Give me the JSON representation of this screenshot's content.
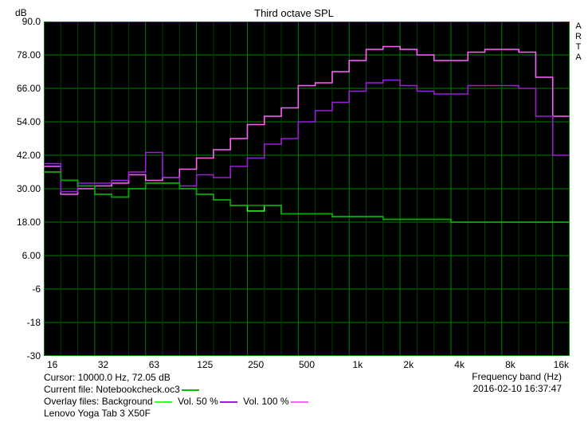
{
  "title": "Third octave SPL",
  "ylabel": "dB",
  "xlabel": "Frequency band (Hz)",
  "arta_label": "ARTA",
  "timestamp": "2016-02-10  16:37:47",
  "cursor_label": "Cursor: 10000.0 Hz, 72.05 dB",
  "file_label_prefix": "Current file: ",
  "file_name": "Notebookcheck.oc3",
  "overlay_label_prefix": "Overlay files: ",
  "overlay_bg_label": "Background",
  "overlay_50_label": " Vol. 50 %",
  "overlay_100_label": " Vol. 100 %",
  "device_label": "Lenovo Yoga Tab 3 X50F",
  "legend_colors": {
    "notebookcheck": "#00c000",
    "background": "#31ff31",
    "vol50": "#9b1fd6",
    "vol100": "#ff60ff"
  },
  "y_ticks": [
    -30,
    -18,
    -6,
    6,
    18,
    30,
    42,
    54,
    66,
    78,
    90
  ],
  "x_ticks_labels": [
    "16",
    "32",
    "63",
    "125",
    "250",
    "500",
    "1k",
    "2k",
    "4k",
    "8k",
    "16k"
  ],
  "x_ticks_band_index": [
    0,
    3,
    6,
    9,
    12,
    15,
    18,
    21,
    24,
    27,
    30
  ],
  "chart_data": {
    "type": "step-line",
    "title": "Third octave SPL",
    "xlabel": "Frequency band (Hz)",
    "ylabel": "dB",
    "ylim": [
      -30,
      90
    ],
    "x_bands_hz": [
      16,
      20,
      25,
      31.5,
      40,
      50,
      63,
      80,
      100,
      125,
      160,
      200,
      250,
      315,
      400,
      500,
      630,
      800,
      1000,
      1250,
      1600,
      2000,
      2500,
      3150,
      4000,
      5000,
      6300,
      8000,
      10000,
      12500,
      16000
    ],
    "series": [
      {
        "name": "Vol. 100 %",
        "color": "#ff60ff",
        "values": [
          38,
          28,
          30,
          31,
          32,
          35,
          33,
          34,
          37,
          41,
          44,
          48,
          53,
          56,
          59,
          67,
          68,
          72,
          76,
          80,
          81,
          80,
          78,
          76,
          76,
          79,
          80,
          80,
          79,
          70,
          56
        ]
      },
      {
        "name": "Vol. 50 %",
        "color": "#9b1fd6",
        "values": [
          39,
          29,
          32,
          32,
          33,
          36,
          43,
          34,
          31,
          35,
          34,
          38,
          41,
          46,
          48,
          54,
          58,
          61,
          65,
          68,
          69,
          67,
          65,
          64,
          64,
          67,
          67,
          67,
          66,
          56,
          42
        ]
      },
      {
        "name": "Background",
        "color": "#31ff31",
        "values": [
          36,
          33,
          31,
          28,
          27,
          30,
          32,
          32,
          30,
          28,
          26,
          24,
          22,
          24,
          21,
          21,
          21,
          20,
          20,
          20,
          19,
          19,
          19,
          19,
          18,
          18,
          18,
          18,
          18,
          18,
          18
        ]
      },
      {
        "name": "Notebookcheck.oc3",
        "color": "#00a000",
        "values": [
          36,
          33,
          31,
          28,
          27,
          30,
          32,
          32,
          30,
          28,
          26,
          24,
          24,
          24,
          21,
          21,
          21,
          20,
          20,
          20,
          19,
          19,
          19,
          19,
          18,
          18,
          18,
          18,
          18,
          18,
          18
        ]
      }
    ]
  }
}
